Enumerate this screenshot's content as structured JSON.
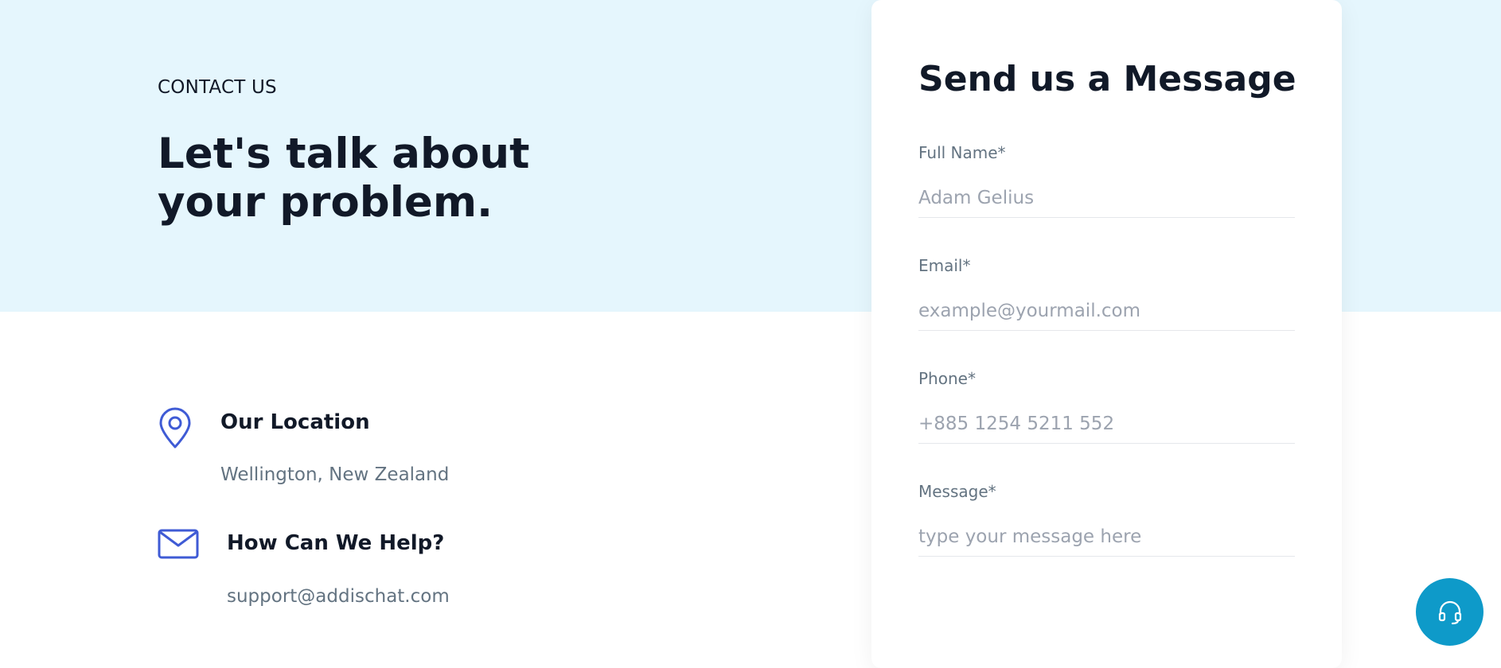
{
  "hero": {
    "eyebrow": "CONTACT US",
    "headline_line1": "Let's talk about",
    "headline_line2": "your problem."
  },
  "contact_info": [
    {
      "icon": "location-pin-icon",
      "title": "Our Location",
      "text": "Wellington, New Zealand"
    },
    {
      "icon": "envelope-icon",
      "title": "How Can We Help?",
      "text": "support@addischat.com"
    }
  ],
  "form": {
    "title": "Send us a Message",
    "fields": [
      {
        "label": "Full Name*",
        "placeholder": "Adam Gelius",
        "value": ""
      },
      {
        "label": "Email*",
        "placeholder": "example@yourmail.com",
        "value": ""
      },
      {
        "label": "Phone*",
        "placeholder": "+885 1254 5211 552",
        "value": ""
      },
      {
        "label": "Message*",
        "placeholder": "type your message here",
        "value": ""
      }
    ]
  },
  "support_button": {
    "icon": "headset-icon"
  },
  "colors": {
    "hero_background": "#e5f6fd",
    "heading": "#111928",
    "muted_text": "#637381",
    "placeholder": "#9ca3af",
    "icon_accent": "#3f5bd5",
    "support_button": "#0e9ac9"
  }
}
